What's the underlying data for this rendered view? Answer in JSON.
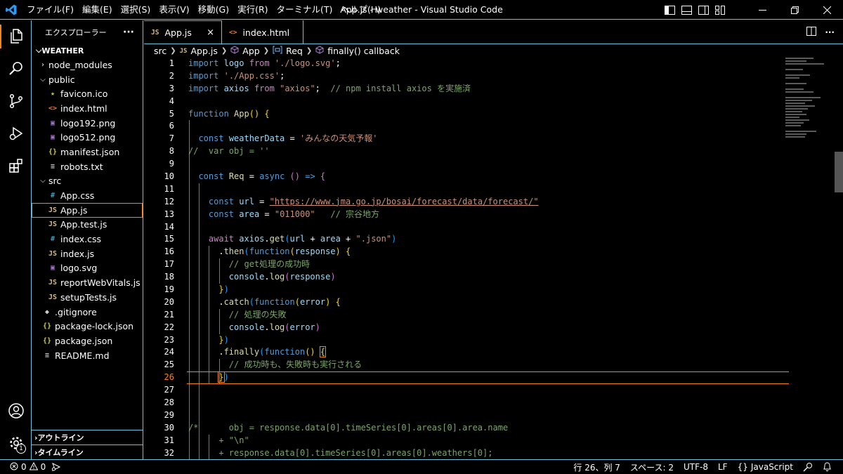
{
  "window": {
    "title": "App.js - weather - Visual Studio Code",
    "accent_color": "#6fc3df",
    "active_color": "#f38518"
  },
  "menu": [
    "ファイル(F)",
    "編集(E)",
    "選択(S)",
    "表示(V)",
    "移動(G)",
    "実行(R)",
    "ターミナル(T)",
    "ヘルプ(H)"
  ],
  "sidebar": {
    "header": "エクスプローラー",
    "more_label": "···",
    "root": "WEATHER",
    "tree": [
      {
        "label": "node_modules",
        "type": "folder",
        "open": false,
        "depth": 1
      },
      {
        "label": "public",
        "type": "folder",
        "open": true,
        "depth": 1
      },
      {
        "label": "favicon.ico",
        "type": "star",
        "depth": 2
      },
      {
        "label": "index.html",
        "type": "html",
        "depth": 2
      },
      {
        "label": "logo192.png",
        "type": "img",
        "depth": 2
      },
      {
        "label": "logo512.png",
        "type": "img",
        "depth": 2
      },
      {
        "label": "manifest.json",
        "type": "json",
        "depth": 2
      },
      {
        "label": "robots.txt",
        "type": "txt",
        "depth": 2
      },
      {
        "label": "src",
        "type": "folder",
        "open": true,
        "depth": 1
      },
      {
        "label": "App.css",
        "type": "css",
        "depth": 2
      },
      {
        "label": "App.js",
        "type": "js",
        "depth": 2,
        "selected": true
      },
      {
        "label": "App.test.js",
        "type": "js",
        "depth": 2
      },
      {
        "label": "index.css",
        "type": "css",
        "depth": 2
      },
      {
        "label": "index.js",
        "type": "js",
        "depth": 2
      },
      {
        "label": "logo.svg",
        "type": "img",
        "depth": 2
      },
      {
        "label": "reportWebVitals.js",
        "type": "js",
        "depth": 2
      },
      {
        "label": "setupTests.js",
        "type": "js",
        "depth": 2
      },
      {
        "label": ".gitignore",
        "type": "git",
        "depth": 1
      },
      {
        "label": "package-lock.json",
        "type": "json",
        "depth": 1
      },
      {
        "label": "package.json",
        "type": "json",
        "depth": 1
      },
      {
        "label": "README.md",
        "type": "txt",
        "depth": 1
      }
    ],
    "outline_label": "アウトライン",
    "timeline_label": "タイムライン"
  },
  "tabs": [
    {
      "label": "App.js",
      "icon": "JS",
      "active": true,
      "close": "×"
    },
    {
      "label": "index.html",
      "icon": "<>",
      "active": false
    }
  ],
  "breadcrumb": {
    "src": "src",
    "file_icon": "JS",
    "file": "App.js",
    "app": "App",
    "req": "Req",
    "callback": "finally() callback"
  },
  "editor": {
    "current_line": 26,
    "lines": [
      [
        [
          "kw",
          "import"
        ],
        [
          "def",
          " "
        ],
        [
          "var",
          "logo"
        ],
        [
          "def",
          " "
        ],
        [
          "ctl",
          "from"
        ],
        [
          "def",
          " "
        ],
        [
          "str",
          "'./logo.svg'"
        ],
        [
          "def",
          ";"
        ]
      ],
      [
        [
          "kw",
          "import"
        ],
        [
          "def",
          " "
        ],
        [
          "str",
          "'./App.css'"
        ],
        [
          "def",
          ";"
        ]
      ],
      [
        [
          "kw",
          "import"
        ],
        [
          "def",
          " "
        ],
        [
          "var",
          "axios"
        ],
        [
          "def",
          " "
        ],
        [
          "ctl",
          "from"
        ],
        [
          "def",
          " "
        ],
        [
          "str",
          "\"axios\""
        ],
        [
          "def",
          ";  "
        ],
        [
          "com",
          "// npm install axios を実施済"
        ]
      ],
      [],
      [
        [
          "kw",
          "function"
        ],
        [
          "def",
          " "
        ],
        [
          "fn",
          "App"
        ],
        [
          "br1",
          "()"
        ],
        [
          "def",
          " "
        ],
        [
          "br1",
          "{"
        ]
      ],
      [],
      [
        [
          "def",
          "  "
        ],
        [
          "kw",
          "const"
        ],
        [
          "def",
          " "
        ],
        [
          "var",
          "weatherData"
        ],
        [
          "def",
          " = "
        ],
        [
          "str",
          "'みんなの天気予報'"
        ]
      ],
      [
        [
          "com",
          "//  var obj = ''"
        ]
      ],
      [],
      [
        [
          "def",
          "  "
        ],
        [
          "kw",
          "const"
        ],
        [
          "def",
          " "
        ],
        [
          "fn",
          "Req"
        ],
        [
          "def",
          " = "
        ],
        [
          "kw",
          "async"
        ],
        [
          "def",
          " "
        ],
        [
          "br2",
          "()"
        ],
        [
          "def",
          " "
        ],
        [
          "kw",
          "=>"
        ],
        [
          "def",
          " "
        ],
        [
          "br2",
          "{"
        ]
      ],
      [],
      [
        [
          "def",
          "    "
        ],
        [
          "kw",
          "const"
        ],
        [
          "def",
          " "
        ],
        [
          "var",
          "url"
        ],
        [
          "def",
          " = "
        ],
        [
          "strurl",
          "\"https://www.jma.go.jp/bosai/forecast/data/forecast/\""
        ]
      ],
      [
        [
          "def",
          "    "
        ],
        [
          "kw",
          "const"
        ],
        [
          "def",
          " "
        ],
        [
          "var",
          "area"
        ],
        [
          "def",
          " = "
        ],
        [
          "str",
          "\"011000\""
        ],
        [
          "def",
          "   "
        ],
        [
          "com",
          "// 宗谷地方"
        ]
      ],
      [],
      [
        [
          "def",
          "    "
        ],
        [
          "ctl",
          "await"
        ],
        [
          "def",
          " "
        ],
        [
          "var",
          "axios"
        ],
        [
          "def",
          "."
        ],
        [
          "fn",
          "get"
        ],
        [
          "br3",
          "("
        ],
        [
          "var",
          "url"
        ],
        [
          "def",
          " + "
        ],
        [
          "var",
          "area"
        ],
        [
          "def",
          " + "
        ],
        [
          "str",
          "\".json\""
        ],
        [
          "br3",
          ")"
        ]
      ],
      [
        [
          "def",
          "      ."
        ],
        [
          "fn",
          "then"
        ],
        [
          "br3",
          "("
        ],
        [
          "kw",
          "function"
        ],
        [
          "br1",
          "("
        ],
        [
          "var",
          "response"
        ],
        [
          "br1",
          ")"
        ],
        [
          "def",
          " "
        ],
        [
          "br1",
          "{"
        ]
      ],
      [
        [
          "def",
          "        "
        ],
        [
          "com",
          "// get処理の成功時"
        ]
      ],
      [
        [
          "def",
          "        "
        ],
        [
          "var",
          "console"
        ],
        [
          "def",
          "."
        ],
        [
          "fn",
          "log"
        ],
        [
          "br2",
          "("
        ],
        [
          "var",
          "response"
        ],
        [
          "br2",
          ")"
        ]
      ],
      [
        [
          "def",
          "      "
        ],
        [
          "br1",
          "}"
        ],
        [
          "br3",
          ")"
        ]
      ],
      [
        [
          "def",
          "      ."
        ],
        [
          "fn",
          "catch"
        ],
        [
          "br3",
          "("
        ],
        [
          "kw",
          "function"
        ],
        [
          "br1",
          "("
        ],
        [
          "var",
          "error"
        ],
        [
          "br1",
          ")"
        ],
        [
          "def",
          " "
        ],
        [
          "br1",
          "{"
        ]
      ],
      [
        [
          "def",
          "        "
        ],
        [
          "com",
          "// 処理の失敗"
        ]
      ],
      [
        [
          "def",
          "        "
        ],
        [
          "var",
          "console"
        ],
        [
          "def",
          "."
        ],
        [
          "fn",
          "log"
        ],
        [
          "br2",
          "("
        ],
        [
          "var",
          "error"
        ],
        [
          "br2",
          ")"
        ]
      ],
      [
        [
          "def",
          "      "
        ],
        [
          "br1",
          "}"
        ],
        [
          "br3",
          ")"
        ]
      ],
      [
        [
          "def",
          "      ."
        ],
        [
          "fn",
          "finally"
        ],
        [
          "br3",
          "("
        ],
        [
          "kw",
          "function"
        ],
        [
          "br1",
          "()"
        ],
        [
          "def",
          " "
        ],
        [
          "br1m",
          "{"
        ]
      ],
      [
        [
          "def",
          "        "
        ],
        [
          "com",
          "// 成功時も、失敗時も実行される"
        ]
      ],
      [
        [
          "def",
          "      "
        ],
        [
          "br1m",
          "}"
        ],
        [
          "br3",
          ")"
        ]
      ],
      [],
      [],
      [],
      [
        [
          "com",
          "/*      obj = response.data[0].timeSeries[0].areas[0].area.name"
        ]
      ],
      [
        [
          "com",
          "      + \"\\n\""
        ]
      ],
      [
        [
          "com",
          "      + response.data[0].timeSeries[0].areas[0].weathers[0];"
        ]
      ]
    ]
  },
  "status": {
    "errors": "0",
    "warnings": "0",
    "position": "行 26、列 7",
    "spaces": "スペース: 2",
    "encoding": "UTF-8",
    "eol": "LF",
    "language": "JavaScript",
    "language_icon": "{}"
  },
  "icons": {
    "app": "vscode-logo-icon",
    "explorer": "files-icon",
    "search": "search-icon",
    "scm": "source-control-icon",
    "debug": "run-debug-icon",
    "extensions": "extensions-icon",
    "account": "account-icon",
    "settings": "gear-icon",
    "settings_badge": "1"
  }
}
